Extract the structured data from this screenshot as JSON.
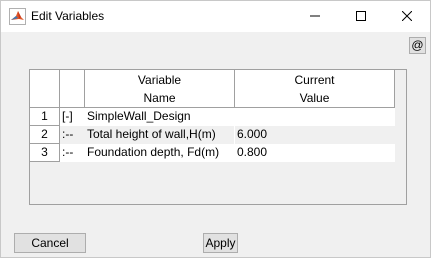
{
  "window": {
    "title": "Edit Variables",
    "app_icon": "matlab-icon",
    "controls": [
      "minimize-icon",
      "maximize-icon",
      "close-icon"
    ]
  },
  "toolbar": {
    "at_button_label": "@"
  },
  "table": {
    "headers": {
      "variable_line1": "Variable",
      "variable_line2": "Name",
      "value_line1": "Current",
      "value_line2": "Value"
    },
    "rows": [
      {
        "num": "1",
        "tree": "[-]",
        "name": "SimpleWall_Design",
        "value": ""
      },
      {
        "num": "2",
        "tree": ":--",
        "name": "Total height of wall,H(m)",
        "value": "6.000"
      },
      {
        "num": "3",
        "tree": ":--",
        "name": "Foundation depth, Fd(m)",
        "value": "0.800"
      }
    ]
  },
  "buttons": {
    "cancel": "Cancel",
    "apply": "Apply"
  }
}
